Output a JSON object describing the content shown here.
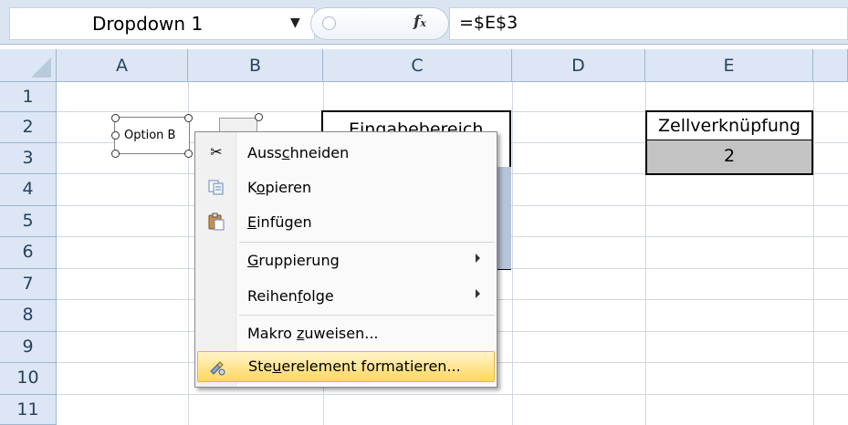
{
  "formula_bar": {
    "name_box": "Dropdown 1",
    "fx_label": "fx",
    "formula": "=$E$3"
  },
  "columns": [
    "A",
    "B",
    "C",
    "D",
    "E"
  ],
  "rows": [
    "1",
    "2",
    "3",
    "4",
    "5",
    "6",
    "7",
    "8",
    "9",
    "10",
    "11"
  ],
  "cells": {
    "c2_title": "Eingabebereich",
    "e2_title": "Zellverknüpfung",
    "e3_value": "2"
  },
  "control": {
    "label": "Option B"
  },
  "context_menu": {
    "items": [
      {
        "pre": "Auss",
        "key": "c",
        "post": "hneiden",
        "icon": "scissors-icon"
      },
      {
        "pre": "K",
        "key": "o",
        "post": "pieren",
        "icon": "copy-icon"
      },
      {
        "pre": "",
        "key": "E",
        "post": "infügen",
        "icon": "paste-icon"
      },
      {
        "pre": "",
        "key": "G",
        "post": "ruppierung",
        "icon": "",
        "submenu": true
      },
      {
        "pre": "Reihen",
        "key": "f",
        "post": "olge",
        "icon": "",
        "submenu": true
      },
      {
        "pre": "Makro ",
        "key": "z",
        "post": "uweisen...",
        "icon": ""
      },
      {
        "pre": "Ste",
        "key": "u",
        "post": "erelement formatieren...",
        "icon": "format-control-icon",
        "highlighted": true
      }
    ]
  },
  "colors": {
    "header_bg": "#dce6f4",
    "menu_highlight": "#ffd75e",
    "linked_cell_bg": "#c3c3c3"
  }
}
